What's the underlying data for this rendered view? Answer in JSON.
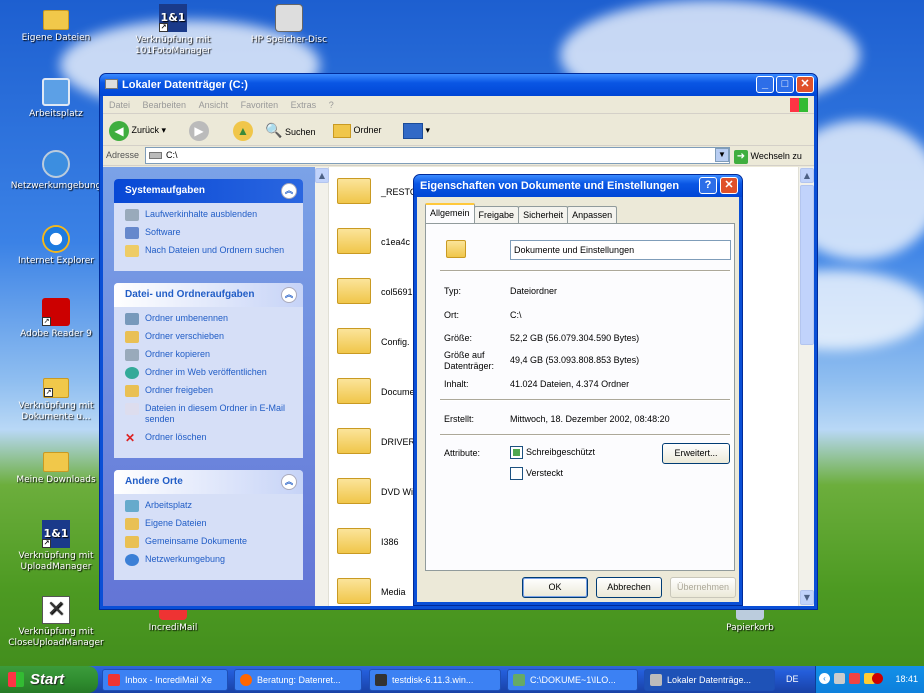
{
  "desktop": {
    "icons": [
      {
        "label": "Eigene Dateien",
        "icon": "my-documents-icon"
      },
      {
        "label": "Verknüpfung mit 101FotoManager",
        "icon": "1und1-icon"
      },
      {
        "label": "HP Speicher-Disc",
        "icon": "disc-drive-icon"
      },
      {
        "label": "Arbeitsplatz",
        "icon": "my-computer-icon"
      },
      {
        "label": "Netzwerkumgebung",
        "icon": "network-icon"
      },
      {
        "label": "Internet Explorer",
        "icon": "internet-explorer-icon"
      },
      {
        "label": "Adobe Reader 9",
        "icon": "adobe-reader-icon"
      },
      {
        "label": "Verknüpfung mit Dokumente u...",
        "icon": "folder-shortcut-icon"
      },
      {
        "label": "Meine Downloads",
        "icon": "folder-icon"
      },
      {
        "label": "Verknüpfung mit UploadManager",
        "icon": "1und1-icon"
      },
      {
        "label": "Verknüpfung mit CloseUploadManager",
        "icon": "close-x-icon"
      },
      {
        "label": "IncrediMail",
        "icon": "incredimail-icon"
      },
      {
        "label": "Papierkorb",
        "icon": "recycle-bin-icon"
      }
    ]
  },
  "explorer": {
    "title": "Lokaler Datenträger (C:)",
    "menu": [
      "Datei",
      "Bearbeiten",
      "Ansicht",
      "Favoriten",
      "Extras",
      "?"
    ],
    "toolbar": {
      "back": "Zurück",
      "search": "Suchen",
      "folders": "Ordner"
    },
    "address": {
      "label": "Adresse",
      "value": "C:\\",
      "go": "Wechseln zu"
    },
    "system_tasks": {
      "title": "Systemaufgaben",
      "items": [
        "Laufwerkinhalte ausblenden",
        "Software",
        "Nach Dateien und Ordnern suchen"
      ]
    },
    "file_tasks": {
      "title": "Datei- und Ordneraufgaben",
      "items": [
        "Ordner umbenennen",
        "Ordner verschieben",
        "Ordner kopieren",
        "Ordner im Web veröffentlichen",
        "Ordner freigeben",
        "Dateien in diesem Ordner in E-Mail senden",
        "Ordner löschen"
      ]
    },
    "other_places": {
      "title": "Andere Orte",
      "items": [
        "Arbeitsplatz",
        "Eigene Dateien",
        "Gemeinsame Dokumente",
        "Netzwerkumgebung"
      ]
    },
    "files": [
      "_RESTO",
      "c1ea4c",
      "col5691",
      "Config.",
      "Docume",
      "DRIVER",
      "DVD Wi",
      "I386",
      "Media"
    ]
  },
  "properties": {
    "title": "Eigenschaften von Dokumente und Einstellungen",
    "tabs": [
      "Allgemein",
      "Freigabe",
      "Sicherheit",
      "Anpassen"
    ],
    "name": "Dokumente und Einstellungen",
    "type_label": "Typ:",
    "type_value": "Dateiordner",
    "location_label": "Ort:",
    "location_value": "C:\\",
    "size_label": "Größe:",
    "size_value": "52,2 GB (56.079.304.590 Bytes)",
    "disk_size_label": "Größe auf Datenträger:",
    "disk_size_value": "49,4 GB (53.093.808.853 Bytes)",
    "content_label": "Inhalt:",
    "content_value": "41.024 Dateien, 4.374 Ordner",
    "created_label": "Erstellt:",
    "created_value": "Mittwoch, 18. Dezember 2002, 08:48:20",
    "attributes_label": "Attribute:",
    "readonly_label": "Schreibgeschützt",
    "hidden_label": "Versteckt",
    "advanced_button": "Erweitert...",
    "ok_button": "OK",
    "cancel_button": "Abbrechen",
    "apply_button": "Übernehmen"
  },
  "taskbar": {
    "start": "Start",
    "buttons": [
      {
        "label": "Inbox - IncrediMail Xe",
        "color": "#e33"
      },
      {
        "label": "Beratung: Datenret...",
        "color": "#f60"
      },
      {
        "label": "testdisk-6.11.3.win...",
        "color": "#333"
      },
      {
        "label": "C:\\DOKUME~1\\ILO...",
        "color": "#6a6"
      },
      {
        "label": "Lokaler Datenträge...",
        "color": "#bbb"
      }
    ],
    "language": "DE",
    "clock": "18:41"
  }
}
